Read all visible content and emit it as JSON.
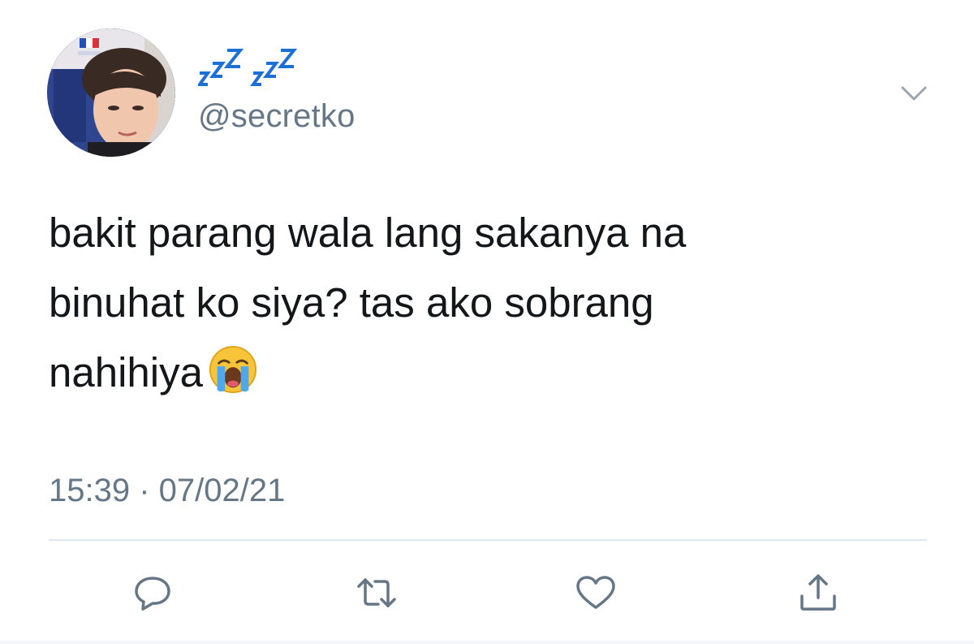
{
  "tweet": {
    "display_name": "zzz zzz",
    "handle": "@secretko",
    "body_lines": [
      "bakit parang wala lang sakanya na",
      "binuhat ko siya? tas ako sobrang",
      "nahihiya"
    ],
    "emoji": "loudly-crying-face",
    "timestamp": "15:39 · 07/02/21",
    "avatar_flag_label": "FRANCE"
  },
  "actions": [
    "reply-icon",
    "retweet-icon",
    "like-icon",
    "share-icon"
  ],
  "colors": {
    "text": "#14171a",
    "secondary": "#657786",
    "divider": "#e1e8ed",
    "name_blue": "#1d6fd8"
  }
}
